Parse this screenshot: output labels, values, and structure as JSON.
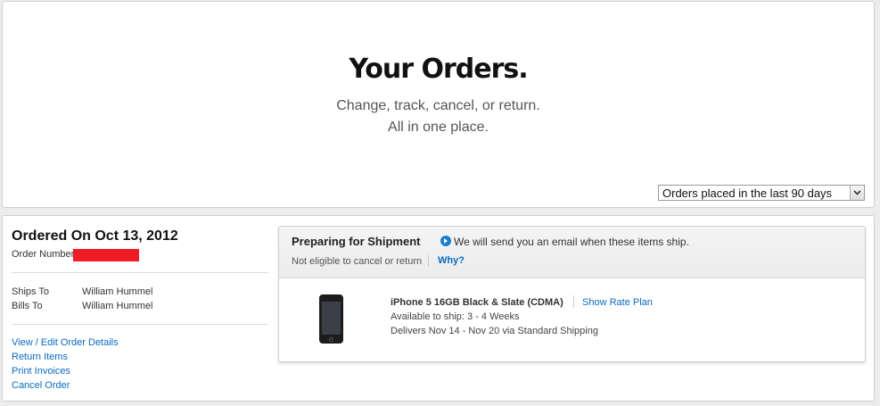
{
  "hero": {
    "title": "Your Orders.",
    "subtitle_line1": "Change, track, cancel, or return.",
    "subtitle_line2": "All in one place."
  },
  "filter": {
    "selected": "Orders placed in the last 90 days"
  },
  "order": {
    "date_label": "Ordered On Oct 13, 2012",
    "number_label": "Order Number",
    "ships_to_label": "Ships To",
    "ships_to_value": "William Hummel",
    "bills_to_label": "Bills To",
    "bills_to_value": "William Hummel",
    "links": {
      "view_edit": "View / Edit Order Details",
      "return": "Return Items",
      "print": "Print Invoices",
      "cancel": "Cancel Order"
    }
  },
  "shipment": {
    "status": "Preparing for Shipment",
    "message": "We will send you an email when these items ship.",
    "note": "Not eligible to cancel or return",
    "why": "Why?",
    "item": {
      "name": "iPhone 5 16GB Black & Slate (CDMA)",
      "rate_plan": "Show Rate Plan",
      "availability": "Available to ship:  3 - 4 Weeks",
      "delivery": "Delivers  Nov 14 - Nov 20 via Standard Shipping"
    }
  },
  "colors": {
    "link": "#0a6ac1",
    "redaction": "#ee1c24",
    "status_arrow": "#1a7dcd"
  },
  "icons": {
    "status": "play-circle-icon",
    "dropdown": "chevron-down-icon",
    "product": "iphone-image"
  }
}
